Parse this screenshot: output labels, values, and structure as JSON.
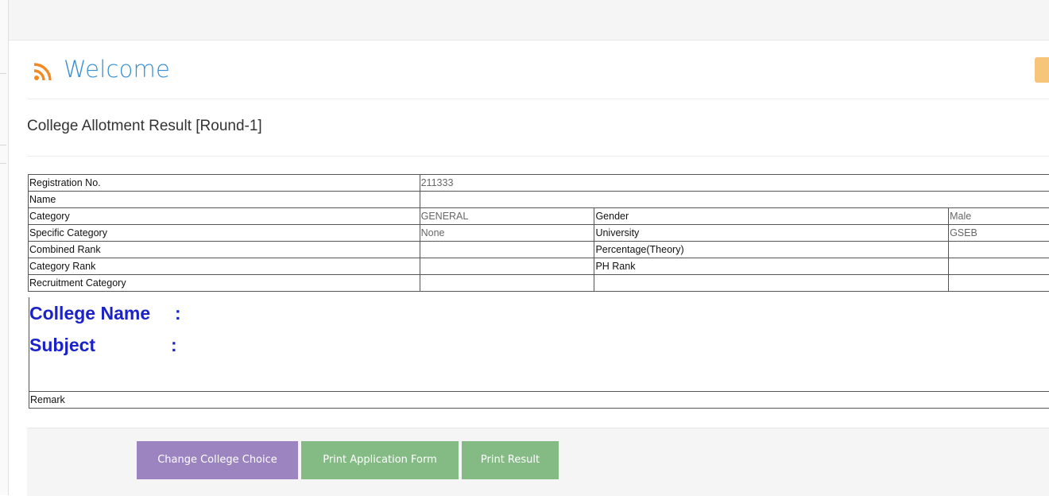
{
  "header": {
    "title": "Welcome"
  },
  "page": {
    "heading": "College Allotment Result [Round-1]"
  },
  "table": {
    "rows": [
      {
        "label": "Registration No.",
        "value": "211333"
      },
      {
        "label": "Name",
        "value": ""
      },
      {
        "label": "Category",
        "value": "GENERAL",
        "label2": "Gender",
        "value2": "Male"
      },
      {
        "label": "Specific Category",
        "value": "None",
        "label2": "University",
        "value2": "GSEB"
      },
      {
        "label": "Combined Rank",
        "value": "",
        "label2": "Percentage(Theory)",
        "value2": ""
      },
      {
        "label": "Category Rank",
        "value": "",
        "label2": "PH Rank",
        "value2": ""
      },
      {
        "label": "Recruitment Category",
        "value": "",
        "label2": "",
        "value2": ""
      }
    ]
  },
  "allotment": {
    "college_label": "College Name",
    "college_colon": ":",
    "subject_label": "Subject",
    "subject_colon": ":"
  },
  "remark": {
    "label": "Remark"
  },
  "buttons": {
    "change_choice": "Change College Choice",
    "print_form": "Print Application Form",
    "print_result": "Print Result"
  },
  "colors": {
    "title_blue": "#3a8fd0",
    "rss_orange": "#f5891f",
    "allotment_blue": "#1a22c8",
    "button_purple": "#9b84c0",
    "button_green": "#84ba84"
  },
  "icons": {
    "feed": "rss-icon"
  }
}
